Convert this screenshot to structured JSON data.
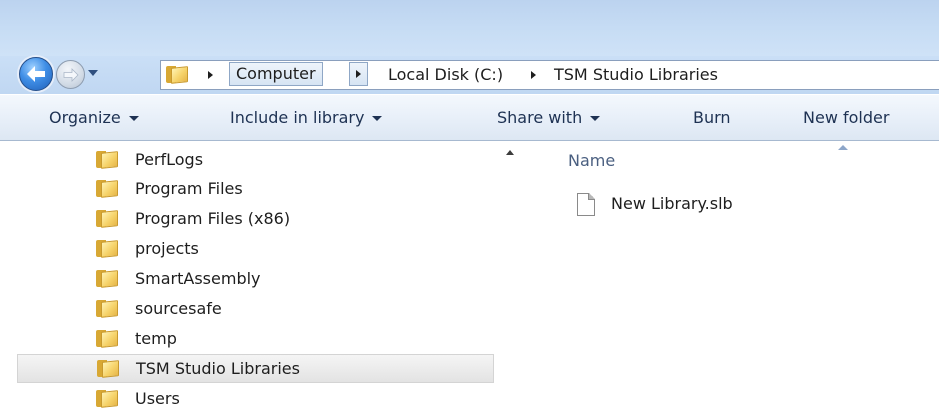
{
  "breadcrumb": {
    "items": [
      "Computer",
      "Local Disk (C:)",
      "TSM Studio Libraries"
    ]
  },
  "toolbar": {
    "organize": "Organize",
    "include_in_library": "Include in library",
    "share_with": "Share with",
    "burn": "Burn",
    "new_folder": "New folder"
  },
  "tree": {
    "items": [
      {
        "label": "PerfLogs"
      },
      {
        "label": "Program Files"
      },
      {
        "label": "Program Files (x86)"
      },
      {
        "label": "projects"
      },
      {
        "label": "SmartAssembly"
      },
      {
        "label": "sourcesafe"
      },
      {
        "label": "temp"
      },
      {
        "label": "TSM Studio Libraries",
        "selected": true
      },
      {
        "label": "Users"
      }
    ]
  },
  "content": {
    "column_header": "Name",
    "files": [
      {
        "name": "New Library.slb"
      }
    ]
  },
  "icons": {
    "back": "back-arrow-icon",
    "forward": "forward-arrow-icon",
    "folder": "folder-icon",
    "file": "file-icon"
  },
  "colors": {
    "frame": "#c6dcf4",
    "back_button": "#3f8ee6",
    "selection": "#e8e8e8"
  }
}
